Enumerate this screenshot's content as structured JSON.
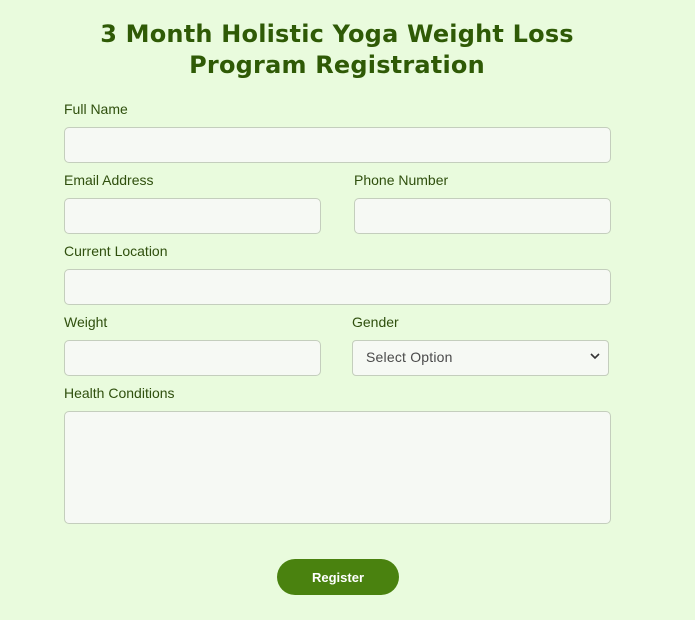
{
  "form": {
    "title": "3 Month Holistic Yoga Weight Loss Program Registration",
    "fields": {
      "full_name": {
        "label": "Full Name",
        "value": ""
      },
      "email": {
        "label": "Email Address",
        "value": ""
      },
      "phone": {
        "label": "Phone Number",
        "value": ""
      },
      "location": {
        "label": "Current Location",
        "value": ""
      },
      "weight": {
        "label": "Weight",
        "value": ""
      },
      "gender": {
        "label": "Gender",
        "selected": "Select Option"
      },
      "health": {
        "label": "Health Conditions",
        "value": ""
      }
    },
    "submit_label": "Register"
  },
  "colors": {
    "background": "#e9fbdd",
    "title": "#2f5a06",
    "button": "#4a820f",
    "field_bg": "#f6f9f4"
  },
  "icons": {
    "gender_select": "chevron-down-icon"
  }
}
